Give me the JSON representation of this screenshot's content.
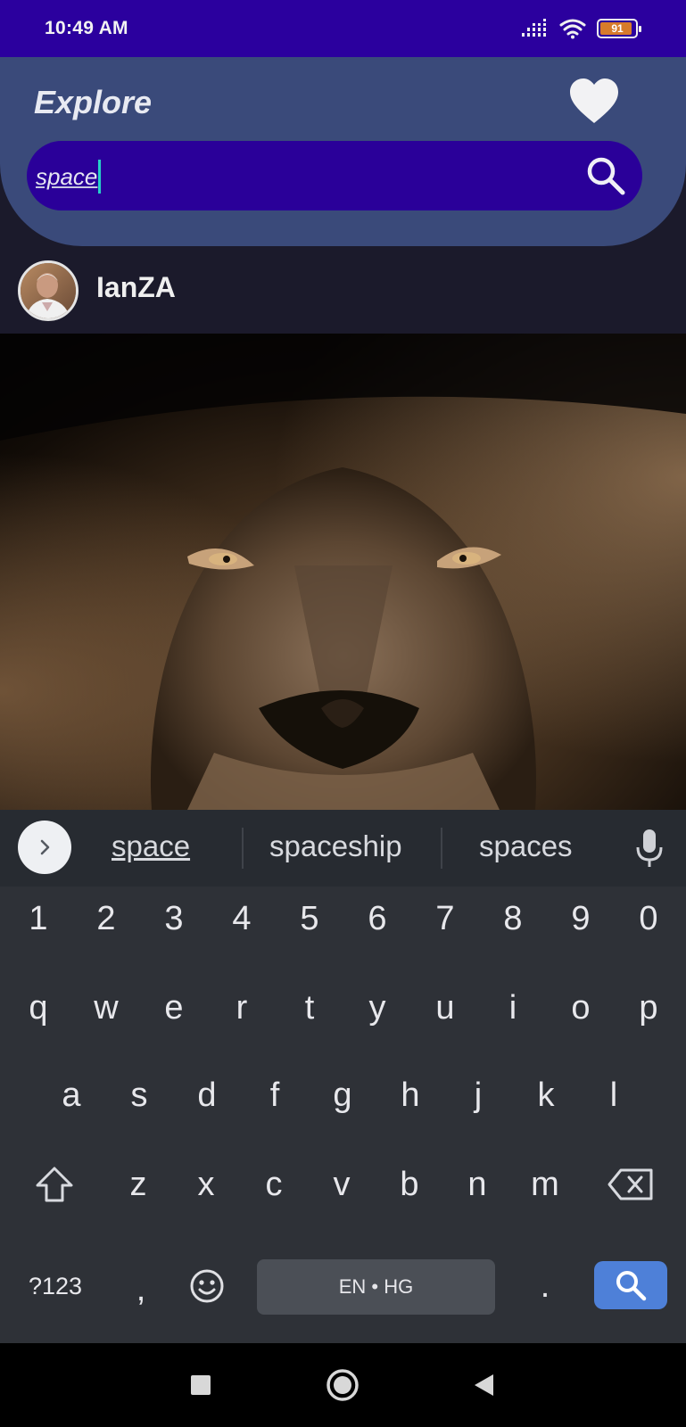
{
  "status_bar": {
    "time": "10:49 AM",
    "battery_level": "91",
    "battery_fraction": 0.91,
    "icons": [
      "signal-icon",
      "wifi-icon",
      "battery-icon"
    ]
  },
  "header": {
    "title": "Explore",
    "favorites_icon": "heart-icon",
    "search": {
      "value": "space",
      "icon": "search-icon"
    }
  },
  "post": {
    "username": "IanZA",
    "avatar": "avatar",
    "image": "lion-photo"
  },
  "keyboard": {
    "suggestions": [
      "space",
      "spaceship",
      "spaces"
    ],
    "number_row": [
      "1",
      "2",
      "3",
      "4",
      "5",
      "6",
      "7",
      "8",
      "9",
      "0"
    ],
    "row1": [
      "q",
      "w",
      "e",
      "r",
      "t",
      "y",
      "u",
      "i",
      "o",
      "p"
    ],
    "row2": [
      "a",
      "s",
      "d",
      "f",
      "g",
      "h",
      "j",
      "k",
      "l"
    ],
    "row3": [
      "z",
      "x",
      "c",
      "v",
      "b",
      "n",
      "m"
    ],
    "symbols_key": "?123",
    "comma_key": ",",
    "period_key": ".",
    "spacebar_label": "EN • HG"
  },
  "colors": {
    "status_bar": "#2b009e",
    "header": "#3a4a7a",
    "search_field": "#2a0099",
    "background": "#1b1a2b",
    "keyboard": "#2e3137",
    "action_key": "#4e80d8"
  }
}
